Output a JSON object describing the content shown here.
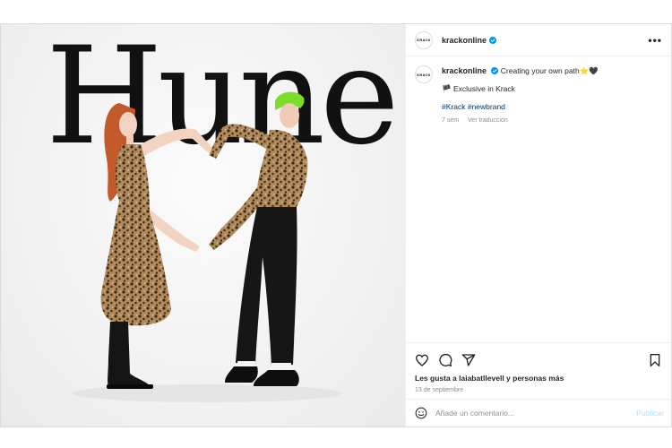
{
  "post": {
    "wordmark": "Hune",
    "account": {
      "username": "krackonline",
      "avatar_text": "KRACK",
      "verified": true
    },
    "more_label": "•••",
    "caption": {
      "text": "Creating your own path⭐🖤",
      "line2": "🏴 Exclusive in Krack",
      "hashtags": [
        "#Krack",
        "#newbrand"
      ],
      "time_ago": "7 sem",
      "translate_label": "Ver traducción"
    },
    "actions": {
      "icons": [
        "heart-icon",
        "comment-icon",
        "share-icon",
        "bookmark-icon"
      ]
    },
    "likes_text": "Les gusta a laiabatllevell y personas más",
    "date": "13 de septiembre",
    "comment_box": {
      "placeholder": "Añade un comentario...",
      "publish_label": "Publicar"
    }
  },
  "colors": {
    "verified": "#0095f6",
    "link": "#00376b",
    "muted": "#8e8e8e",
    "publish_disabled": "#b2dffc"
  }
}
